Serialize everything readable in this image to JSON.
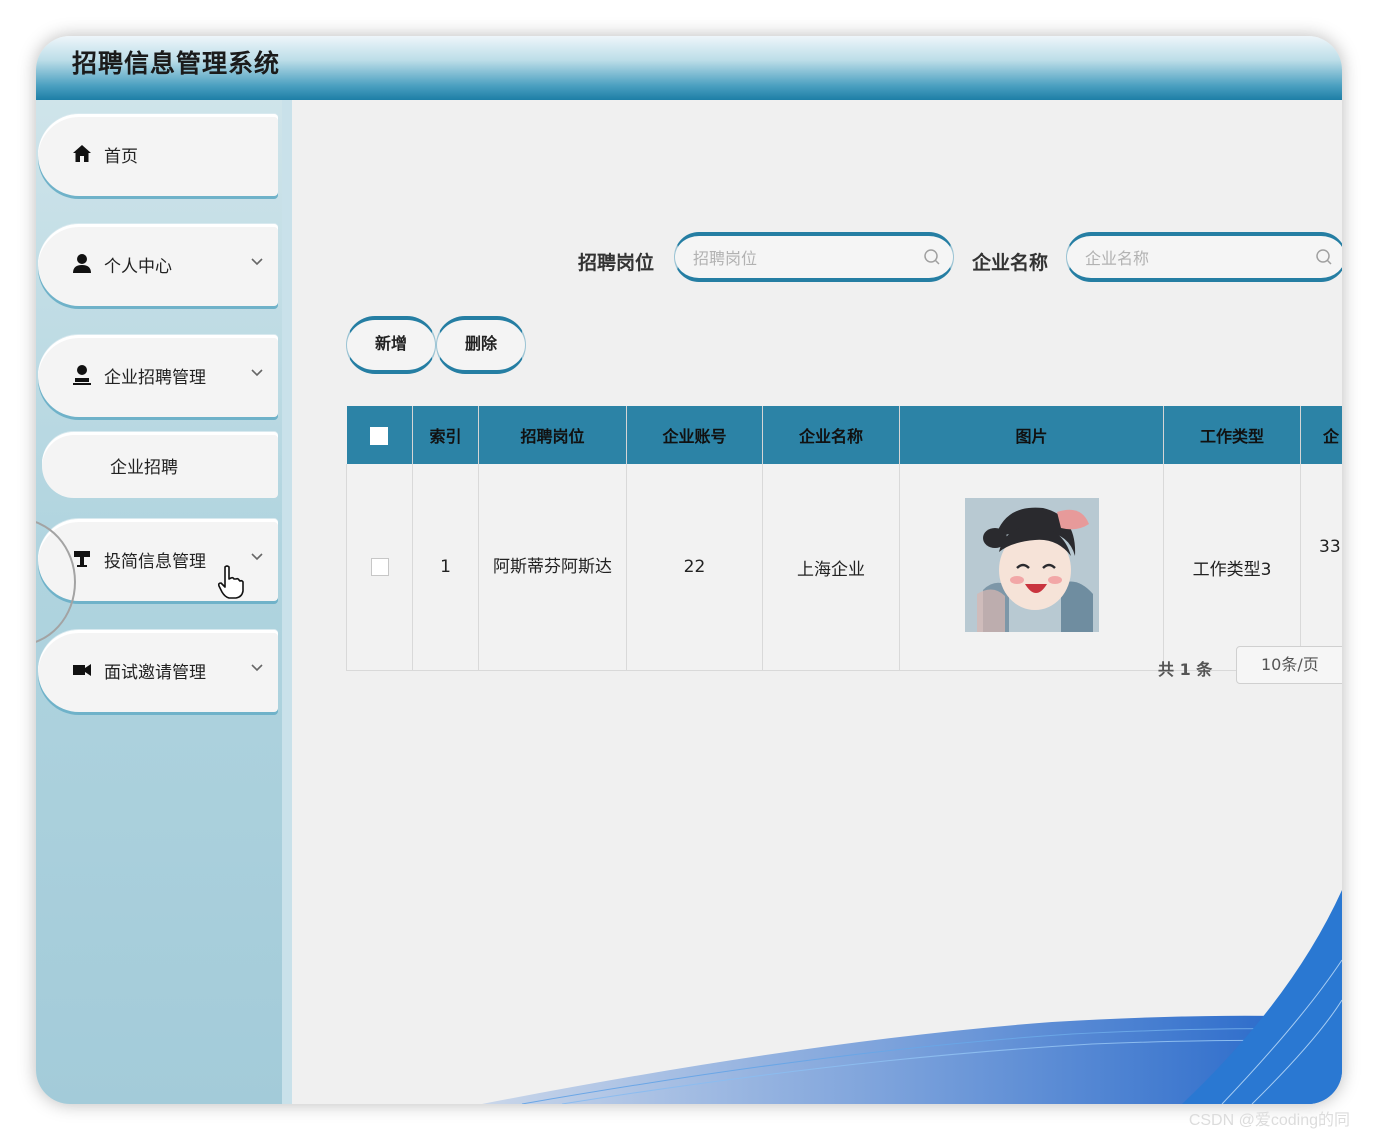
{
  "app": {
    "title": "招聘信息管理系统"
  },
  "sidebar": {
    "items": [
      {
        "label": "首页",
        "icon": "home-icon"
      },
      {
        "label": "个人中心",
        "icon": "user-icon"
      },
      {
        "label": "企业招聘管理",
        "icon": "user-icon",
        "sub_items": [
          {
            "label": "企业招聘"
          }
        ]
      },
      {
        "label": "投简信息管理",
        "icon": "podium-icon"
      },
      {
        "label": "面试邀请管理",
        "icon": "video-camera-icon"
      }
    ]
  },
  "search": {
    "fields": [
      {
        "label": "招聘岗位",
        "placeholder": "招聘岗位",
        "value": ""
      },
      {
        "label": "企业名称",
        "placeholder": "企业名称",
        "value": ""
      }
    ]
  },
  "toolbar": {
    "add_label": "新增",
    "delete_label": "删除"
  },
  "table": {
    "headers": [
      "索引",
      "招聘岗位",
      "企业账号",
      "企业名称",
      "图片",
      "工作类型",
      "企"
    ],
    "rows": [
      {
        "index": "1",
        "position": "阿斯蒂芬阿斯达",
        "account": "22",
        "company": "上海企业",
        "image": "avatar-thumbnail",
        "job_type": "工作类型3",
        "extra": "33"
      }
    ]
  },
  "pagination": {
    "total_label": "共 1 条",
    "page_size": "10条/页"
  },
  "watermark": "CSDN @爱coding的同",
  "colors": {
    "accent": "#257ea3",
    "header_bg": "#2c83a6",
    "sidebar_bg": "#b0d4df"
  }
}
